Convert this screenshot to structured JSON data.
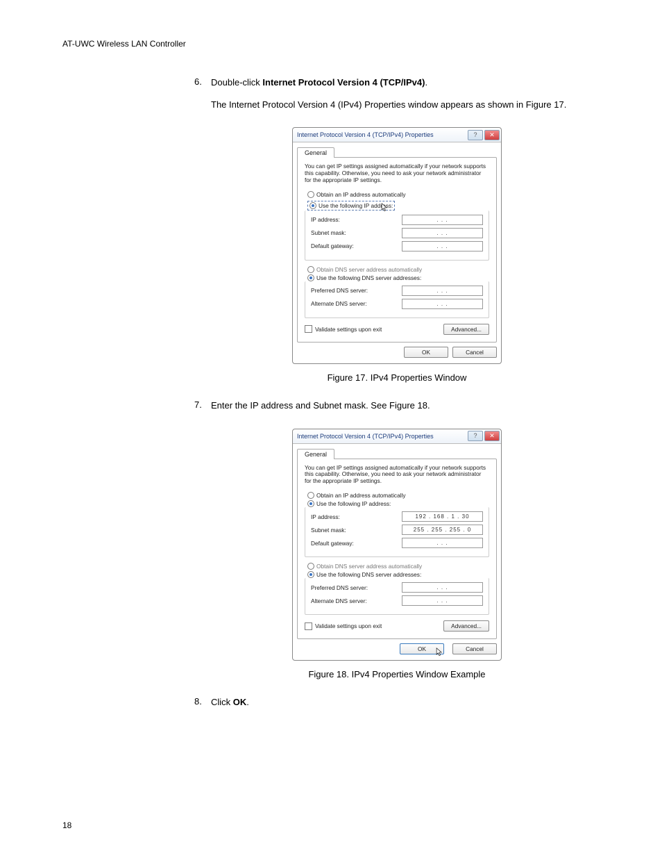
{
  "header": "AT-UWC Wireless LAN Controller",
  "page_number": "18",
  "steps": {
    "s6": {
      "num": "6.",
      "text_prefix": "Double-click ",
      "text_bold": "Internet Protocol Version 4 (TCP/IPv4)",
      "text_suffix": ".",
      "followup": "The Internet Protocol Version 4 (IPv4) Properties window appears as shown in Figure 17."
    },
    "s7": {
      "num": "7.",
      "text": "Enter the IP address and Subnet mask. See Figure 18."
    },
    "s8": {
      "num": "8.",
      "text_prefix": "Click ",
      "text_bold": "OK",
      "text_suffix": "."
    }
  },
  "captions": {
    "fig17": "Figure 17. IPv4 Properties Window",
    "fig18": "Figure 18. IPv4 Properties Window Example"
  },
  "dialog": {
    "title": "Internet Protocol Version 4 (TCP/IPv4) Properties",
    "tab_general": "General",
    "intro": "You can get IP settings assigned automatically if your network supports this capability. Otherwise, you need to ask your network administrator for the appropriate IP settings.",
    "opt_obtain_ip": "Obtain an IP address automatically",
    "opt_use_ip": "Use the following IP address:",
    "lbl_ip": "IP address:",
    "lbl_subnet": "Subnet mask:",
    "lbl_gateway": "Default gateway:",
    "opt_obtain_dns": "Obtain DNS server address automatically",
    "opt_use_dns": "Use the following DNS server addresses:",
    "lbl_pref_dns": "Preferred DNS server:",
    "lbl_alt_dns": "Alternate DNS server:",
    "chk_validate": "Validate settings upon exit",
    "btn_adv": "Advanced...",
    "btn_ok": "OK",
    "btn_cancel": "Cancel",
    "empty_ip": ".     .     .",
    "win_help": "?",
    "win_close": "✕"
  },
  "dialog18_values": {
    "ip": "192 . 168 .  1  . 30",
    "subnet": "255 . 255 . 255 .  0"
  }
}
